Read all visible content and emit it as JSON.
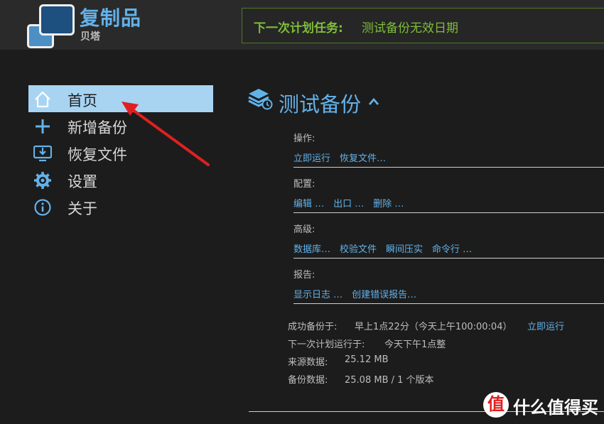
{
  "app": {
    "title": "复制品",
    "subtitle": "贝塔"
  },
  "next_task": {
    "label": "下一次计划任务:",
    "value": "测试备份无效日期"
  },
  "sidebar": {
    "items": [
      {
        "label": "首页",
        "icon": "home-icon"
      },
      {
        "label": "新增备份",
        "icon": "plus-icon"
      },
      {
        "label": "恢复文件",
        "icon": "restore-icon"
      },
      {
        "label": "设置",
        "icon": "gear-icon"
      },
      {
        "label": "关于",
        "icon": "info-icon"
      }
    ]
  },
  "panel": {
    "title": "测试备份",
    "sections": {
      "operations": {
        "heading": "操作:",
        "links": [
          "立即运行",
          "恢复文件…"
        ]
      },
      "config": {
        "heading": "配置:",
        "links": [
          "编辑 …",
          "出口 …",
          "删除 …"
        ]
      },
      "advanced": {
        "heading": "高级:",
        "links": [
          "数据库…",
          "校验文件",
          "瞬间压实",
          "命令行 …"
        ]
      },
      "reports": {
        "heading": "报告:",
        "links": [
          "显示日志 …",
          "创建错误报告…"
        ]
      }
    },
    "info": {
      "success_label": "成功备份于:",
      "success_value": "早上1点22分（今天上午100:00:04）",
      "success_link": "立即运行",
      "next_label": "下一次计划运行于:",
      "next_value": "今天下午1点整",
      "source_label": "来源数据:",
      "source_value": "25.12 MB",
      "backup_label": "备份数据:",
      "backup_value": "25.08 MB / 1 个版本"
    }
  },
  "watermark": {
    "badge": "值",
    "text": "什么值得买"
  },
  "colors": {
    "accent": "#62b2ea",
    "active_nav": "#a8d4f2",
    "task_green": "#7fbd3a",
    "arrow": "#e02020"
  }
}
